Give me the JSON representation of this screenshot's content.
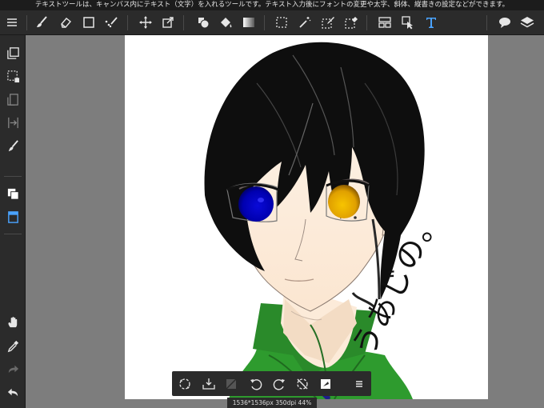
{
  "hint_text": "テキストツールは、キャンバス内にテキスト（文字）を入れるツールです。テキスト入力後にフォントの変更や太字、斜体、縦書きの設定などができます。",
  "status_text": "1536*1536px 350dpi 44%",
  "canvas_text": "うあじの。",
  "colors": {
    "toolbar_bg": "#2b2b2b",
    "active_accent": "#4aa3ff",
    "canvas_bg": "#ffffff",
    "workspace_bg": "#7d7d7d"
  },
  "toolbar": {
    "left": [
      "menu-icon",
      "brush-icon",
      "eraser-icon",
      "square-icon",
      "magic-brush-icon"
    ],
    "middle": [
      "move-icon",
      "transform-icon",
      "fill-shape-icon",
      "bucket-icon",
      "gradient-icon",
      "select-rect-icon",
      "magic-wand-icon",
      "select-pen-icon",
      "select-eraser-icon",
      "frame-icon",
      "operation-icon",
      "text-icon"
    ],
    "right": [
      "speech-bubble-icon",
      "layers-icon"
    ]
  },
  "sidebar": [
    "copy-icon",
    "deselect-icon",
    "snap-icon",
    "ruler-icon",
    "brush-small-icon",
    "color-swatch-icon",
    "layer-panel-icon",
    "hand-icon",
    "eyedropper-icon",
    "redo-icon",
    "undo-icon"
  ],
  "bottom_tools": [
    "rotate-canvas-icon",
    "snap-download-icon",
    "clear-icon",
    "undo-icon",
    "redo-icon",
    "no-transform-icon",
    "fill-icon",
    "menu-icon"
  ]
}
